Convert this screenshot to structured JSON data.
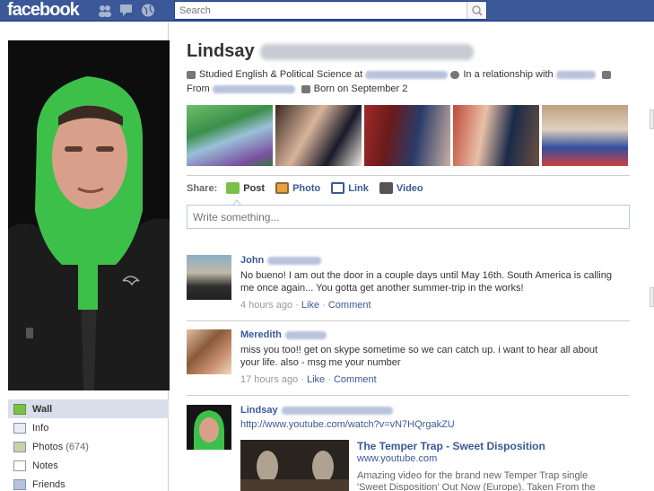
{
  "topbar": {
    "logo": "facebook",
    "search_placeholder": "Search"
  },
  "profile": {
    "first_name": "Lindsay",
    "studied": "Studied English & Political Science at",
    "relationship": "In a relationship with",
    "from_label": "From",
    "born": "Born on September 2"
  },
  "nav": {
    "items": [
      {
        "label": "Wall",
        "count": ""
      },
      {
        "label": "Info",
        "count": ""
      },
      {
        "label": "Photos",
        "count": "(674)"
      },
      {
        "label": "Notes",
        "count": ""
      },
      {
        "label": "Friends",
        "count": ""
      }
    ]
  },
  "share": {
    "label": "Share:",
    "post": "Post",
    "photo": "Photo",
    "link": "Link",
    "video": "Video",
    "placeholder": "Write something..."
  },
  "feed": [
    {
      "actor": "John",
      "message": "No bueno! I am out the door in a couple days until May 16th. South America is calling me once again... You gotta get another summer-trip in the works!",
      "time": "4 hours ago",
      "like": "Like",
      "comment": "Comment"
    },
    {
      "actor": "Meredith",
      "message": "miss you too!! get on skype sometime so we can catch up. i want to hear all about your life. also - msg me your number",
      "time": "17 hours ago",
      "like": "Like",
      "comment": "Comment"
    },
    {
      "actor": "Lindsay",
      "url": "http://www.youtube.com/watch?v=vN7HQrgakZU",
      "att_title": "The Temper Trap - Sweet Disposition",
      "att_url": "www.youtube.com",
      "att_desc": "Amazing video for the brand new Temper Trap single 'Sweet Disposition' Out Now (Europe). Taken From the"
    }
  ],
  "colors": {
    "brand": "#3b5998",
    "link": "#3b5998",
    "hoodie": "#3cc04a"
  }
}
